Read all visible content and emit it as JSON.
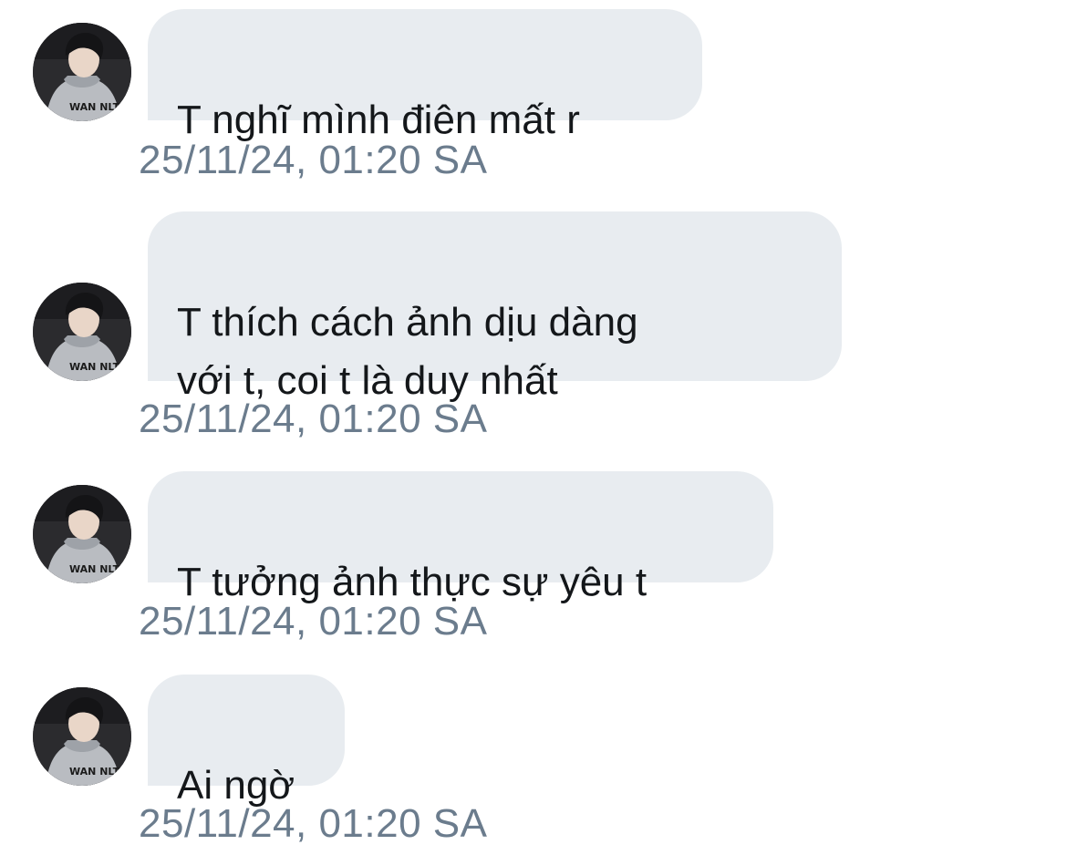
{
  "messages": [
    {
      "text": "T nghĩ mình điên mất r",
      "timestamp": "25/11/24, 01:20 SA"
    },
    {
      "text": "T thích cách ảnh dịu dàng\nvới t, coi t là duy nhất",
      "timestamp": "25/11/24, 01:20 SA"
    },
    {
      "text": "T tưởng ảnh thực sự yêu t",
      "timestamp": "25/11/24, 01:20 SA"
    },
    {
      "text": "Ai ngờ",
      "timestamp": "25/11/24, 01:20 SA"
    }
  ],
  "avatar": {
    "icon": "profile-photo-avatar",
    "shirt_text": "WAN NLT?!"
  },
  "colors": {
    "bubble": "#e8ecf0",
    "text": "#14171a",
    "timestamp": "#6b7c8d",
    "background": "#ffffff"
  }
}
